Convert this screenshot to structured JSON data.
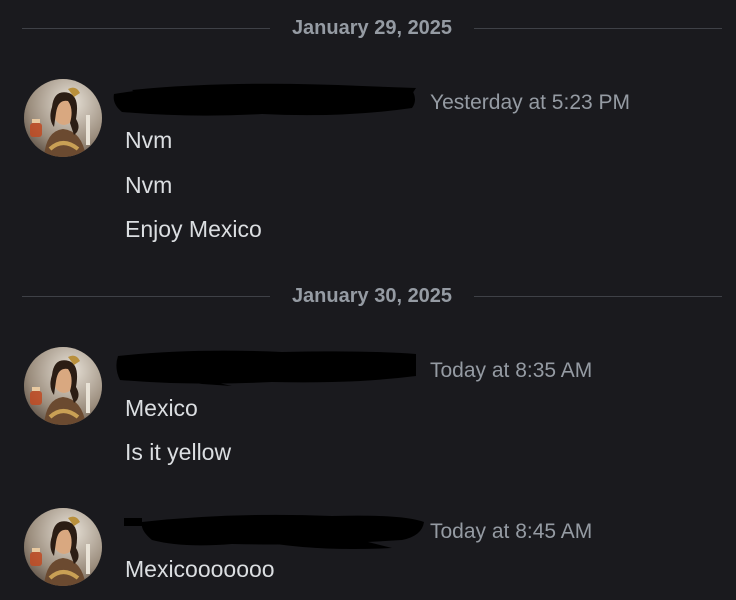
{
  "dividers": [
    {
      "date": "January 29, 2025"
    },
    {
      "date": "January 30, 2025"
    }
  ],
  "messages": [
    {
      "timestamp": "Yesterday at 5:23 PM",
      "lines": [
        "Nvm",
        "Nvm",
        "Enjoy Mexico"
      ]
    },
    {
      "timestamp": "Today at 8:35 AM",
      "lines": [
        "Mexico",
        "Is it yellow"
      ]
    },
    {
      "timestamp": "Today at 8:45 AM",
      "lines": [
        "Mexicooooooo"
      ]
    }
  ],
  "colors": {
    "background": "#1a1a1e",
    "message_text": "#dbdee1",
    "muted_text": "#959ba3",
    "divider": "#3f4147",
    "redaction": "#000000"
  },
  "icons": {
    "avatar": "user-avatar-portrait"
  }
}
